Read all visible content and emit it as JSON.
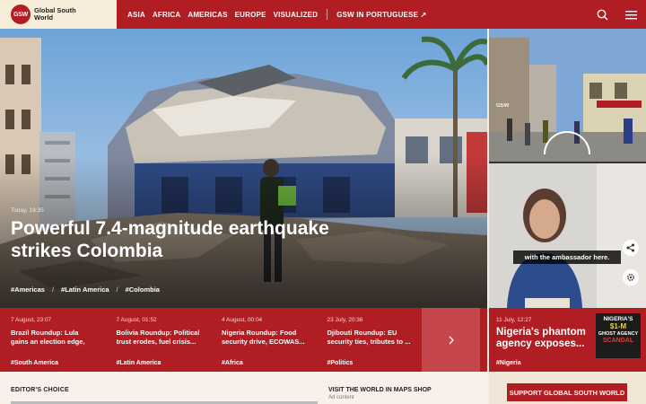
{
  "header": {
    "logo_mark": "GSW",
    "logo_text": "Global South World",
    "nav": [
      "ASIA",
      "AFRICA",
      "AMERICAS",
      "EUROPE",
      "VISUALIZED"
    ],
    "nav_external": "GSW IN PORTUGUESE",
    "icons": [
      "search-icon",
      "menu-icon"
    ]
  },
  "hero": {
    "time": "Today, 19:35",
    "title": "Powerful 7.4-magnitude earthquake strikes Colombia",
    "tags": [
      "#Americas",
      "#Latin America",
      "#Colombia"
    ]
  },
  "side": {
    "watermark": "GSW",
    "subtitle": "with the ambassador here."
  },
  "strip": [
    {
      "date": "7 August, 23:07",
      "title": "Brazil Roundup: Lula gains an election edge, judicial...",
      "tag": "#South America"
    },
    {
      "date": "7 August, 01:52",
      "title": "Bolivia Roundup: Political trust erodes, fuel crisis...",
      "tag": "#Latin America"
    },
    {
      "date": "4 August, 00:04",
      "title": "Nigeria Roundup: Food security drive, ECOWAS...",
      "tag": "#Africa"
    },
    {
      "date": "23 July, 20:36",
      "title": "Djibouti Roundup: EU security ties, tributes to ...",
      "tag": "#Politics"
    }
  ],
  "side_news": {
    "date": "11 July, 12:27",
    "title": "Nigeria's phantom agency exposes...",
    "tag": "#Nigeria",
    "thumb_text": [
      "NIGERIA'S",
      "$1-M",
      "GHOST AGENCY",
      "SCANDAL"
    ]
  },
  "bottom": {
    "editors_choice": "EDITOR'S CHOICE",
    "maps_shop": "VISIT THE WORLD IN MAPS SHOP",
    "ad_content": "Ad content",
    "support": "SUPPORT GLOBAL SOUTH WORLD"
  },
  "colors": {
    "brand_red": "#b01e23",
    "cream": "#f7ecd9"
  }
}
